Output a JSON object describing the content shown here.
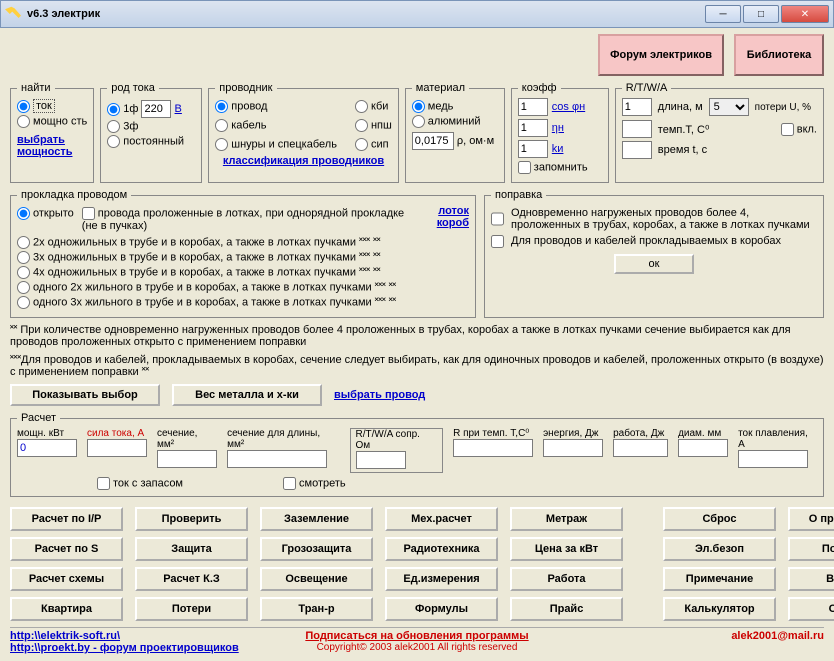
{
  "window": {
    "title": "v6.3 электрик"
  },
  "top": {
    "forum": "Форум электриков",
    "library": "Библиотека"
  },
  "find": {
    "legend": "найти",
    "opt_tok": "ток",
    "opt_power": "мощно сть",
    "select_power": "выбрать мощность"
  },
  "current": {
    "legend": "род тока",
    "ph1": "1ф",
    "val": "220",
    "volt": "В",
    "ph3": "3ф",
    "dc": "постоянный"
  },
  "conductor": {
    "legend": "проводник",
    "wire": "провод",
    "kbi": "кби",
    "cable": "кабель",
    "npsh": "нпш",
    "cords": "шнуры и спецкабель",
    "sip": "сип",
    "classif": "классификация проводников"
  },
  "material": {
    "legend": "материал",
    "copper": "медь",
    "alum": "алюминий",
    "rho_val": "0,0175",
    "rho_lbl": "ρ, ом·м"
  },
  "coeff": {
    "legend": "коэфф",
    "v1": "1",
    "v2": "1",
    "v3": "1",
    "cos": "cos φн",
    "eta": "ηн",
    "ki": "kи",
    "remember": "запомнить"
  },
  "rtwa": {
    "legend": "R/T/W/A",
    "len_val": "1",
    "len_lbl": "длина, м",
    "loss_val": "5",
    "loss_lbl": "потери U, %",
    "temp_lbl": "темп.Т, С⁰",
    "incl": "вкл.",
    "time_lbl": "время t, с"
  },
  "laying": {
    "legend": "прокладка проводом",
    "open": "открыто",
    "open_note": "провода проложенные в лотках, при однорядной прокладке (не в пучках)",
    "tray": "лоток короб",
    "o1": "2х одножильных в трубе и в коробах, а также в лотках пучками ˟˟˟   ˟˟",
    "o2": "3х одножильных в трубе и в коробах, а также в лотках пучками ˟˟˟   ˟˟",
    "o3": "4х одножильных в трубе и в коробах, а также в лотках пучками ˟˟˟   ˟˟",
    "o4": "одного 2х жильного в трубе и в коробах, а также в лотках пучками ˟˟˟   ˟˟",
    "o5": "одного 3х жильного в трубе и в коробах, а также в лотках пучками ˟˟˟   ˟˟"
  },
  "correction": {
    "legend": "поправка",
    "c1": "Одновременно нагруженых проводов более 4, проложенных в трубах, коробах, а также в лотках пучками",
    "c2": "Для проводов и кабелей прокладываемых в коробах",
    "ok": "ок"
  },
  "notes": {
    "n1": "˟˟ При количестве одновременно нагруженных проводов более 4 проложенных в трубах, коробах а также в лотках пучками сечение выбирается как для проводов проложенных открыто с применением поправки",
    "n2": "˟˟˟Для проводов и кабелей, прокладываемых в коробах, сечение следует выбирать, как для одиночных проводов и кабелей, проложенных открыто (в воздухе) с применением поправки ˟˟"
  },
  "mid": {
    "show": "Показывать выбор",
    "weight": "Вес металла и х-ки",
    "select": "выбрать провод"
  },
  "calc": {
    "legend": "Расчет",
    "power": "мощн. кВт",
    "power_val": "0",
    "current": "сила тока, А",
    "section": "сечение, мм²",
    "section_len": "сечение для длины, мм²",
    "rtwa": "R/T/W/A сопр. Ом",
    "rtemp": "R при темп. Т,С⁰",
    "energy": "энергия, Дж",
    "work": "работа, Дж",
    "diam": "диам. мм",
    "melt": "ток плавления, А",
    "margin": "ток с запасом",
    "view": "смотреть"
  },
  "btns": {
    "r1": [
      "Расчет по I/P",
      "Проверить",
      "Заземление",
      "Мех.расчет",
      "Метраж"
    ],
    "r2": [
      "Расчет по S",
      "Защита",
      "Грозозащита",
      "Радиотехника",
      "Цена за кВт"
    ],
    "r3": [
      "Расчет схемы",
      "Расчет К.З",
      "Освещение",
      "Ед.измерения",
      "Работа"
    ],
    "r4": [
      "Квартира",
      "Потери",
      "Тран-р",
      "Формулы",
      "Прайс"
    ],
    "right": [
      "Сброс",
      "О программе",
      "Эл.безоп",
      "Помощь",
      "Примечание",
      "Выход",
      "Калькулятор",
      "Отчет"
    ]
  },
  "footer": {
    "url1": "http:\\\\elektrik-soft.ru\\",
    "url2": "http:\\\\proekt.by - форум проектировщиков",
    "sub": "Подписаться на обновления программы",
    "copy": "Copyright© 2003 alek2001 All rights reserved",
    "email": "alek2001@mail.ru"
  }
}
